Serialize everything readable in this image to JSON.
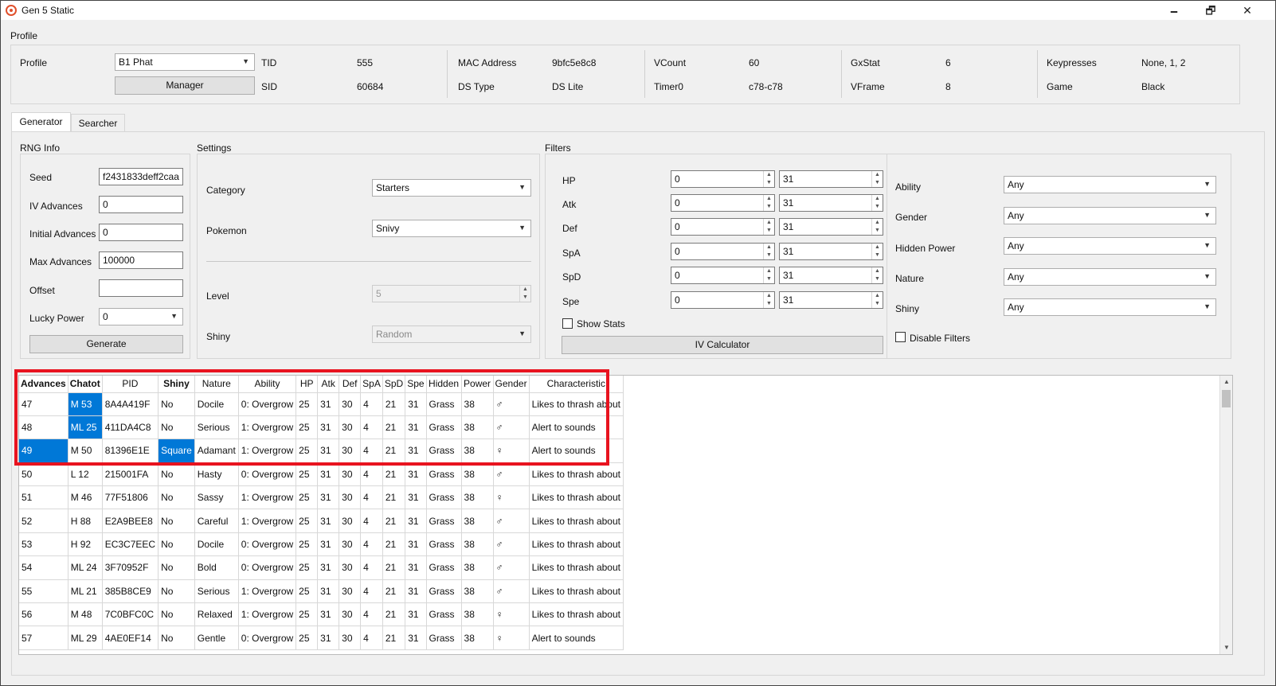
{
  "window": {
    "title": "Gen 5 Static",
    "minimize": "🗕",
    "restore": "🗗",
    "close": "✕"
  },
  "profile_group": {
    "label": "Profile",
    "profile_label": "Profile",
    "profile_value": "B1 Phat",
    "manager_button": "Manager",
    "tid_label": "TID",
    "tid_value": "555",
    "sid_label": "SID",
    "sid_value": "60684",
    "mac_label": "MAC Address",
    "mac_value": "9bfc5e8c8",
    "dstype_label": "DS Type",
    "dstype_value": "DS Lite",
    "vcount_label": "VCount",
    "vcount_value": "60",
    "timer0_label": "Timer0",
    "timer0_value": "c78-c78",
    "gxstat_label": "GxStat",
    "gxstat_value": "6",
    "vframe_label": "VFrame",
    "vframe_value": "8",
    "keypresses_label": "Keypresses",
    "keypresses_value": "None, 1, 2",
    "game_label": "Game",
    "game_value": "Black"
  },
  "tabs": [
    {
      "label": "Generator"
    },
    {
      "label": "Searcher"
    }
  ],
  "rng_info": {
    "title": "RNG Info",
    "seed_label": "Seed",
    "seed_value": "f2431833deff2caa",
    "iv_adv_label": "IV Advances",
    "iv_adv_value": "0",
    "init_adv_label": "Initial Advances",
    "init_adv_value": "0",
    "max_adv_label": "Max Advances",
    "max_adv_value": "100000",
    "offset_label": "Offset",
    "offset_value": "",
    "lucky_label": "Lucky Power",
    "lucky_value": "0",
    "generate_button": "Generate"
  },
  "settings": {
    "title": "Settings",
    "category_label": "Category",
    "category_value": "Starters",
    "pokemon_label": "Pokemon",
    "pokemon_value": "Snivy",
    "level_label": "Level",
    "level_value": "5",
    "shiny_label": "Shiny",
    "shiny_value": "Random"
  },
  "filters": {
    "title": "Filters",
    "stats": [
      {
        "label": "HP",
        "min": "0",
        "max": "31"
      },
      {
        "label": "Atk",
        "min": "0",
        "max": "31"
      },
      {
        "label": "Def",
        "min": "0",
        "max": "31"
      },
      {
        "label": "SpA",
        "min": "0",
        "max": "31"
      },
      {
        "label": "SpD",
        "min": "0",
        "max": "31"
      },
      {
        "label": "Spe",
        "min": "0",
        "max": "31"
      }
    ],
    "show_stats_label": "Show Stats",
    "iv_calc_button": "IV Calculator",
    "ability_label": "Ability",
    "ability_value": "Any",
    "gender_label": "Gender",
    "gender_value": "Any",
    "hp_label": "Hidden Power",
    "hp_value": "Any",
    "nature_label": "Nature",
    "nature_value": "Any",
    "shiny_label": "Shiny",
    "shiny_value": "Any",
    "disable_filters_label": "Disable Filters"
  },
  "results": {
    "headers": [
      "Advances",
      "Chatot",
      "PID",
      "Shiny",
      "Nature",
      "Ability",
      "HP",
      "Atk",
      "Def",
      "SpA",
      "SpD",
      "Spe",
      "Hidden",
      "Power",
      "Gender",
      "Characteristic"
    ],
    "rows": [
      [
        "47",
        "M 53",
        "8A4A419F",
        "No",
        "Docile",
        "0: Overgrow",
        "25",
        "31",
        "30",
        "4",
        "21",
        "31",
        "Grass",
        "38",
        "♂",
        "Likes to thrash about"
      ],
      [
        "48",
        "ML 25",
        "411DA4C8",
        "No",
        "Serious",
        "1: Overgrow",
        "25",
        "31",
        "30",
        "4",
        "21",
        "31",
        "Grass",
        "38",
        "♂",
        "Alert to sounds"
      ],
      [
        "49",
        "M 50",
        "81396E1E",
        "Square",
        "Adamant",
        "1: Overgrow",
        "25",
        "31",
        "30",
        "4",
        "21",
        "31",
        "Grass",
        "38",
        "♀",
        "Alert to sounds"
      ],
      [
        "50",
        "L 12",
        "215001FA",
        "No",
        "Hasty",
        "0: Overgrow",
        "25",
        "31",
        "30",
        "4",
        "21",
        "31",
        "Grass",
        "38",
        "♂",
        "Likes to thrash about"
      ],
      [
        "51",
        "M 46",
        "77F51806",
        "No",
        "Sassy",
        "1: Overgrow",
        "25",
        "31",
        "30",
        "4",
        "21",
        "31",
        "Grass",
        "38",
        "♀",
        "Likes to thrash about"
      ],
      [
        "52",
        "H 88",
        "E2A9BEE8",
        "No",
        "Careful",
        "1: Overgrow",
        "25",
        "31",
        "30",
        "4",
        "21",
        "31",
        "Grass",
        "38",
        "♂",
        "Likes to thrash about"
      ],
      [
        "53",
        "H 92",
        "EC3C7EEC",
        "No",
        "Docile",
        "0: Overgrow",
        "25",
        "31",
        "30",
        "4",
        "21",
        "31",
        "Grass",
        "38",
        "♂",
        "Likes to thrash about"
      ],
      [
        "54",
        "ML 24",
        "3F70952F",
        "No",
        "Bold",
        "0: Overgrow",
        "25",
        "31",
        "30",
        "4",
        "21",
        "31",
        "Grass",
        "38",
        "♂",
        "Likes to thrash about"
      ],
      [
        "55",
        "ML 21",
        "385B8CE9",
        "No",
        "Serious",
        "1: Overgrow",
        "25",
        "31",
        "30",
        "4",
        "21",
        "31",
        "Grass",
        "38",
        "♂",
        "Likes to thrash about"
      ],
      [
        "56",
        "M 48",
        "7C0BFC0C",
        "No",
        "Relaxed",
        "1: Overgrow",
        "25",
        "31",
        "30",
        "4",
        "21",
        "31",
        "Grass",
        "38",
        "♀",
        "Likes to thrash about"
      ],
      [
        "57",
        "ML 29",
        "4AE0EF14",
        "No",
        "Gentle",
        "0: Overgrow",
        "25",
        "31",
        "30",
        "4",
        "21",
        "31",
        "Grass",
        "38",
        "♀",
        "Alert to sounds"
      ]
    ],
    "selected": [
      [
        0,
        1
      ],
      [
        1,
        1
      ],
      [
        2,
        0
      ],
      [
        2,
        3
      ]
    ],
    "bold_headers": [
      0,
      1,
      3
    ]
  }
}
